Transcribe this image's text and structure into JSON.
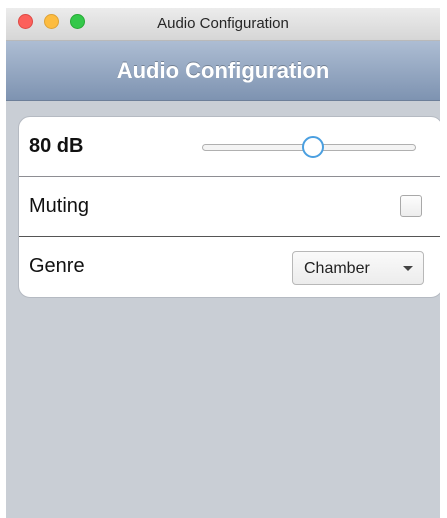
{
  "window": {
    "title": "Audio Configuration"
  },
  "navbar": {
    "title": "Audio Configuration"
  },
  "settings": {
    "volume": {
      "label": "80 dB",
      "slider_fraction": 0.52
    },
    "muting": {
      "label": "Muting",
      "checked": false
    },
    "genre": {
      "label": "Genre",
      "value": "Chamber"
    }
  },
  "colors": {
    "navbar": "#8fa3be",
    "background": "#c9ced5",
    "slider_accent": "#4a9fe0",
    "close": "#fc605b",
    "minimize": "#fdbc40",
    "maximize": "#34c84a"
  }
}
